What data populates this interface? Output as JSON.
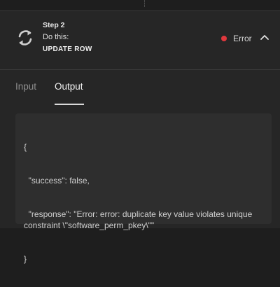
{
  "step": {
    "number_label": "Step 2",
    "instruction": "Do this:",
    "action": "UPDATE ROW",
    "icon": "refresh-icon"
  },
  "status": {
    "label": "Error",
    "color": "#e0383d"
  },
  "tabs": [
    {
      "label": "Input",
      "active": false
    },
    {
      "label": "Output",
      "active": true
    }
  ],
  "output": {
    "lines": [
      "{",
      "  \"success\": false,",
      "  \"response\": \"Error: error: duplicate key value violates unique constraint \\\"software_perm_pkey\\\"\"",
      "}"
    ]
  }
}
